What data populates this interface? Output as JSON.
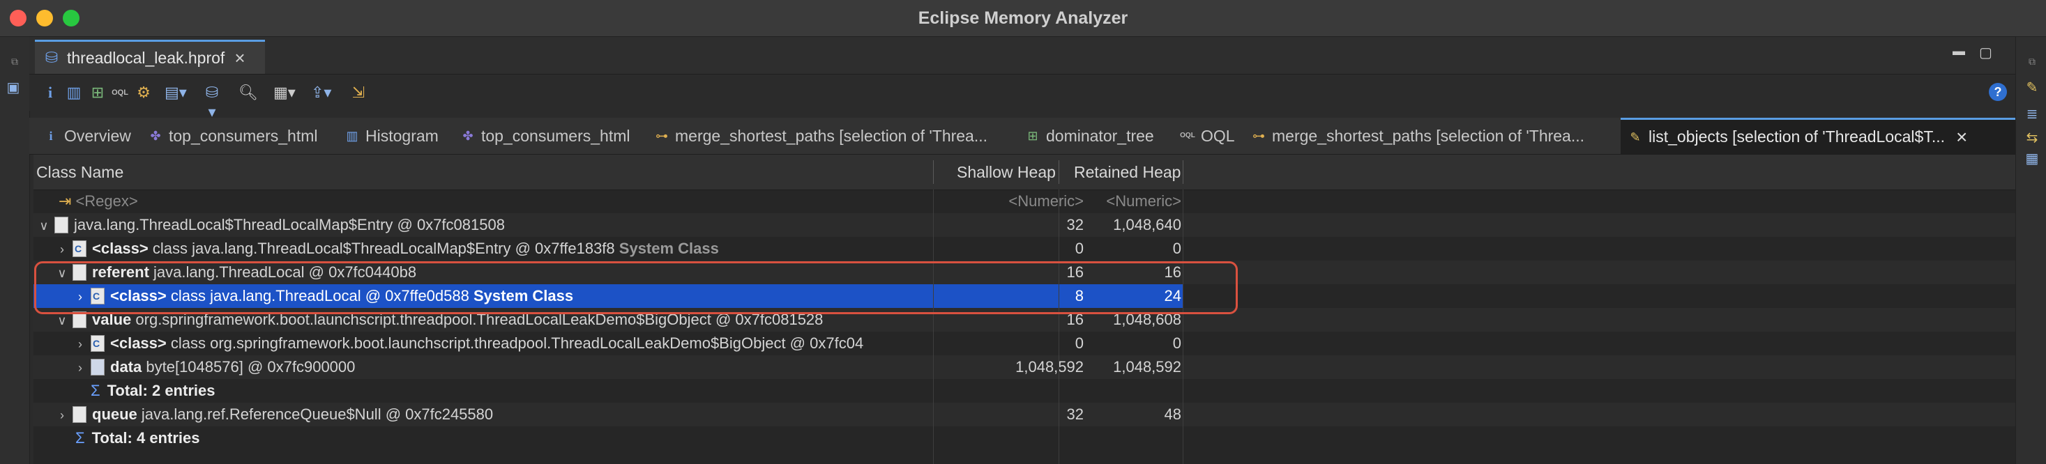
{
  "window": {
    "title": "Eclipse Memory Analyzer"
  },
  "editor_tab": {
    "label": "threadlocal_leak.hprof"
  },
  "inner_tabs": [
    {
      "label": "Overview",
      "icon": "info-icon"
    },
    {
      "label": "top_consumers_html",
      "icon": "report-icon"
    },
    {
      "label": "Histogram",
      "icon": "histogram-icon"
    },
    {
      "label": "top_consumers_html",
      "icon": "report-icon"
    },
    {
      "label": "merge_shortest_paths [selection of 'Threa...",
      "icon": "paths-icon"
    },
    {
      "label": "dominator_tree",
      "icon": "tree-icon"
    },
    {
      "label": "OQL",
      "icon": "oql-icon"
    },
    {
      "label": "merge_shortest_paths [selection of 'Threa...",
      "icon": "paths-icon"
    },
    {
      "label": "list_objects [selection of 'ThreadLocal$T...",
      "icon": "list-icon"
    }
  ],
  "table": {
    "headers": {
      "class_name": "Class Name",
      "shallow": "Shallow Heap",
      "retained": "Retained Heap"
    },
    "filter_row": {
      "name": "<Regex>",
      "shallow": "<Numeric>",
      "retained": "<Numeric>"
    },
    "rows": [
      {
        "prefix": "",
        "text": "java.lang.ThreadLocal$ThreadLocalMap$Entry @ 0x7fc081508",
        "suffix": "",
        "shallow": "32",
        "retained": "1,048,640"
      },
      {
        "prefix": "<class>",
        "text": "class java.lang.ThreadLocal$ThreadLocalMap$Entry @ 0x7ffe183f8",
        "suffix": "System Class",
        "shallow": "0",
        "retained": "0"
      },
      {
        "prefix": "referent",
        "text": "java.lang.ThreadLocal @ 0x7fc0440b8",
        "suffix": "",
        "shallow": "16",
        "retained": "16"
      },
      {
        "prefix": "<class>",
        "text": "class java.lang.ThreadLocal @ 0x7ffe0d588",
        "suffix": "System Class",
        "shallow": "8",
        "retained": "24"
      },
      {
        "prefix": "value",
        "text": "org.springframework.boot.launchscript.threadpool.ThreadLocalLeakDemo$BigObject @ 0x7fc081528",
        "suffix": "",
        "shallow": "16",
        "retained": "1,048,608"
      },
      {
        "prefix": "<class>",
        "text": "class org.springframework.boot.launchscript.threadpool.ThreadLocalLeakDemo$BigObject @ 0x7fc04",
        "suffix": "",
        "shallow": "0",
        "retained": "0"
      },
      {
        "prefix": "data",
        "text": "byte[1048576] @ 0x7fc900000",
        "suffix": "",
        "shallow": "1,048,592",
        "retained": "1,048,592"
      },
      {
        "prefix": "",
        "text": "Total: 2 entries",
        "suffix": "",
        "shallow": "",
        "retained": ""
      },
      {
        "prefix": "queue",
        "text": "java.lang.ref.ReferenceQueue$Null @ 0x7fc245580",
        "suffix": "",
        "shallow": "32",
        "retained": "48"
      },
      {
        "prefix": "",
        "text": "Total: 4 entries",
        "suffix": "",
        "shallow": "",
        "retained": ""
      }
    ]
  },
  "colors": {
    "selection": "#1c52c6",
    "highlight_box": "#d9513f",
    "accent": "#5a9de3"
  }
}
